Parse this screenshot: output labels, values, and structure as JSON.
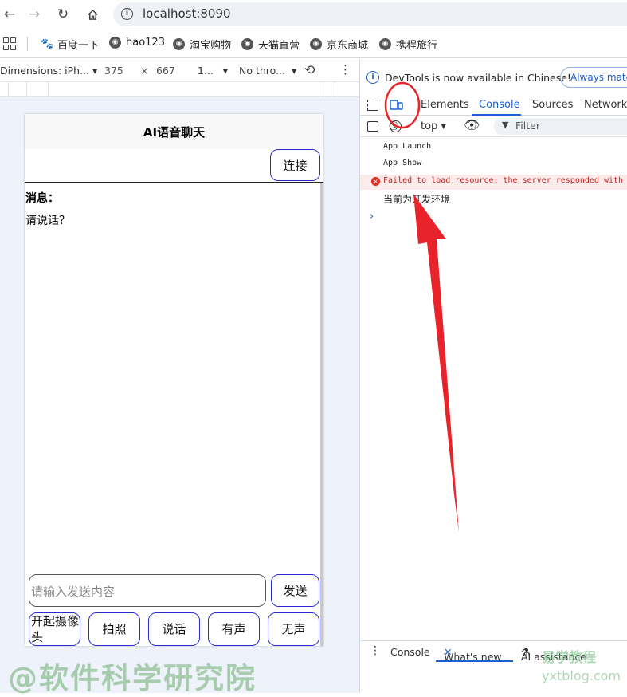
{
  "browser": {
    "url": "localhost:8090",
    "bookmarks": [
      "百度一下",
      "hao123",
      "淘宝购物",
      "天猫直营",
      "京东商城",
      "携程旅行"
    ]
  },
  "emulation": {
    "dimensions": "Dimensions: iPh...",
    "width": "375",
    "height": "667",
    "zoom": "1...",
    "throttle": "No thro..."
  },
  "app": {
    "title": "AI语音聊天",
    "connect_button": "连接",
    "messages_label": "消息：",
    "first_message": "请说话？",
    "input_placeholder": "请输入发送内容",
    "send_button": "发送",
    "buttons": [
      "开起摄像头",
      "拍照",
      "说话",
      "有声",
      "无声"
    ]
  },
  "devtools": {
    "banner_text": "DevTools is now available in Chinese!",
    "banner_button": "Always match",
    "tabs": [
      "Elements",
      "Console",
      "Sources",
      "Network"
    ],
    "active_tab": "Console",
    "context": "top",
    "filter_placeholder": "Filter",
    "logs": [
      "App Launch",
      "App Show",
      "Failed to load resource: the server responded with",
      "当前为开发环境"
    ],
    "drawer_tabs": [
      "Console",
      "What's new",
      "AI assistance"
    ]
  },
  "watermarks": {
    "left": "@软件科学研究院",
    "right": "易学教程",
    "right_url": "yxtblog.com"
  },
  "colors": {
    "accent": "#1a5fd6",
    "app_button_border": "#2b2bd6",
    "annotation": "#e8232a"
  }
}
